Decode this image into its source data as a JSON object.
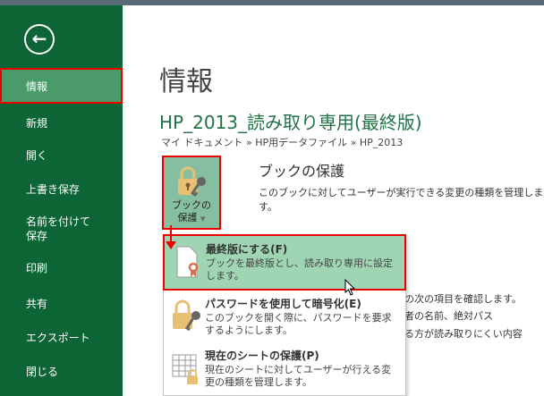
{
  "sidebar": {
    "items": [
      {
        "label": "情報"
      },
      {
        "label": "新規"
      },
      {
        "label": "開く"
      },
      {
        "label": "上書き保存"
      },
      {
        "label": "名前を付けて\n保存"
      },
      {
        "label": "印刷"
      },
      {
        "label": "共有"
      },
      {
        "label": "エクスポート"
      },
      {
        "label": "閉じる"
      }
    ]
  },
  "main": {
    "title": "情報",
    "doc_title": "HP_2013_読み取り専用(最終版)",
    "breadcrumb": "マイ ドキュメント » HP用データファイル » HP_2013",
    "protect_button": {
      "line1": "ブックの",
      "line2": "保護"
    },
    "section_title": "ブックの保護",
    "section_desc": "このブックに対してユーザーが実行できる変更の種類を管理します。",
    "fragments": [
      "の次の項目を確認します。",
      "者の名前、絶対パス",
      "る方が読み取りにくい内容"
    ]
  },
  "menu": {
    "items": [
      {
        "title": "最終版にする(F)",
        "desc": "ブックを最終版とし、読み取り専用に設定します。"
      },
      {
        "title": "パスワードを使用して暗号化(E)",
        "desc": "このブックを開く際に、パスワードを要求するようにします。"
      },
      {
        "title": "現在のシートの保護(P)",
        "desc": "現在のシートに対してユーザーが行える変更の種類を管理します。"
      }
    ]
  }
}
